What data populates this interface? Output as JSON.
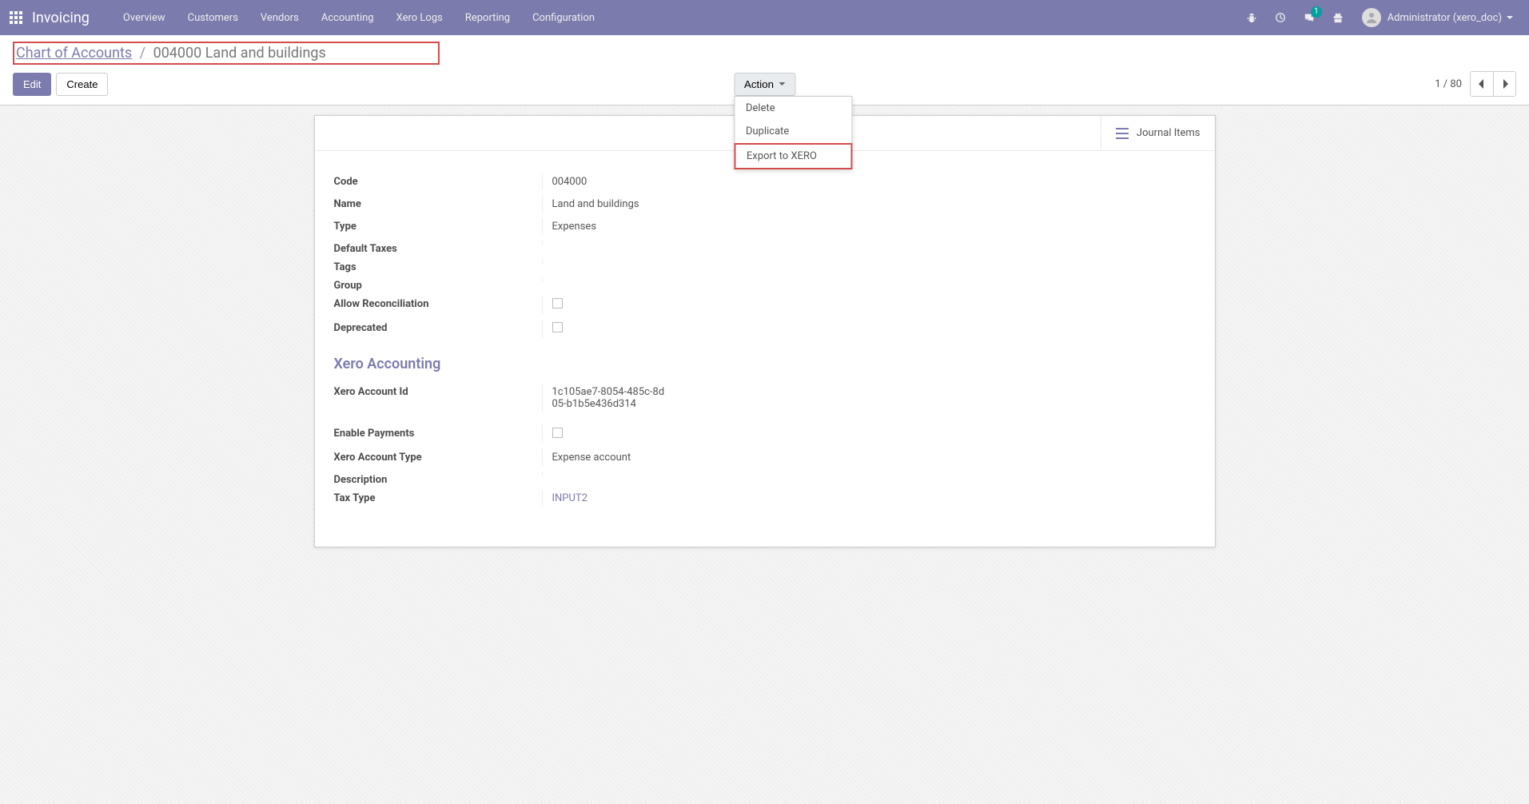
{
  "app_title": "Invoicing",
  "nav": {
    "items": [
      "Overview",
      "Customers",
      "Vendors",
      "Accounting",
      "Xero Logs",
      "Reporting",
      "Configuration"
    ]
  },
  "user": {
    "name": "Administrator (xero_doc)"
  },
  "conversations_badge": "1",
  "breadcrumb": {
    "parent": "Chart of Accounts",
    "current": "004000 Land and buildings"
  },
  "toolbar": {
    "edit": "Edit",
    "create": "Create",
    "action": "Action",
    "dropdown": {
      "delete": "Delete",
      "duplicate": "Duplicate",
      "export_xero": "Export to XERO"
    }
  },
  "pager": {
    "current": "1",
    "sep": "/",
    "total": "80"
  },
  "stat_button": {
    "label": "Journal Items"
  },
  "labels": {
    "code": "Code",
    "name": "Name",
    "type": "Type",
    "default_taxes": "Default Taxes",
    "tags": "Tags",
    "group": "Group",
    "allow_rec": "Allow Reconciliation",
    "deprecated": "Deprecated",
    "xero_section": "Xero Accounting",
    "xero_account_id": "Xero Account Id",
    "enable_payments": "Enable Payments",
    "xero_account_type": "Xero Account Type",
    "description": "Description",
    "tax_type": "Tax Type"
  },
  "values": {
    "code": "004000",
    "name": "Land and buildings",
    "type": "Expenses",
    "default_taxes": "",
    "tags": "",
    "group": "",
    "xero_account_id": "1c105ae7-8054-485c-8d05-b1b5e436d314",
    "xero_account_type": "Expense account",
    "description": "",
    "tax_type": "INPUT2"
  }
}
